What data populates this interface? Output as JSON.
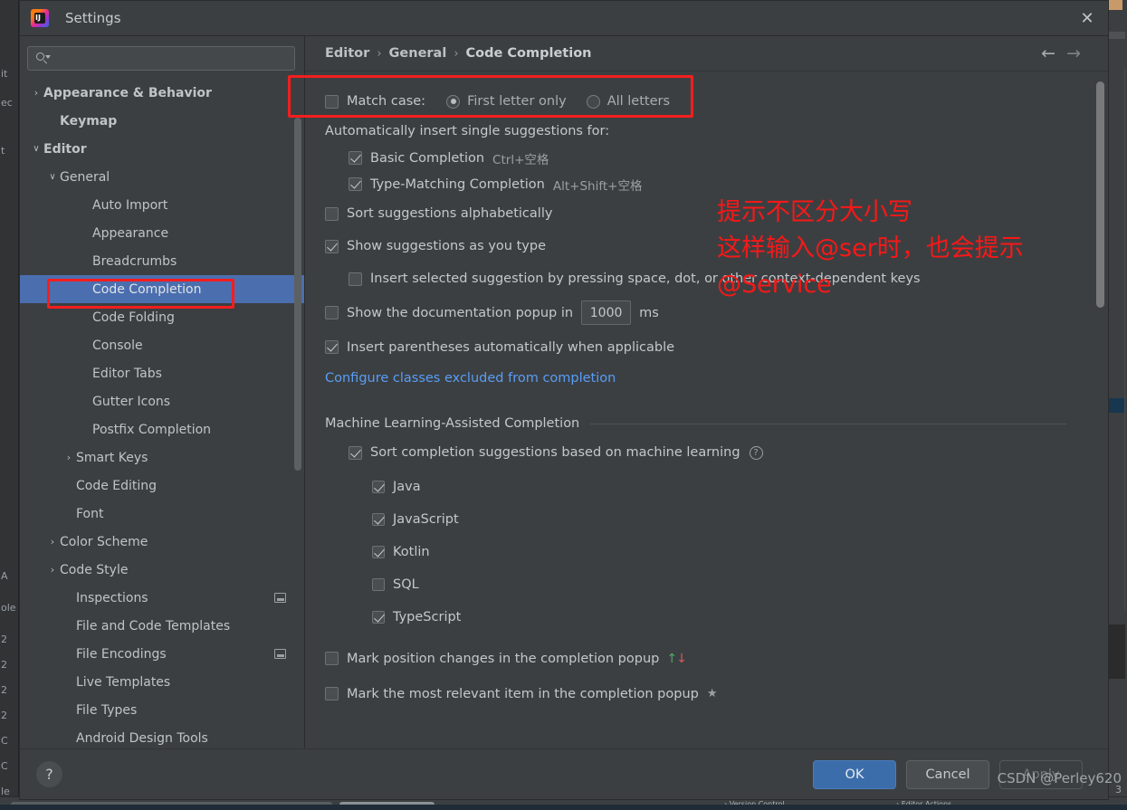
{
  "window": {
    "title": "Settings",
    "app_icon": "intellij-idea-icon",
    "close_label": "✕"
  },
  "search": {
    "value": "",
    "placeholder": ""
  },
  "sidebar": {
    "items": [
      {
        "label": "Appearance & Behavior",
        "arrow": "›",
        "indent": 0,
        "bold": true,
        "selected": false,
        "badge": false
      },
      {
        "label": "Keymap",
        "arrow": "",
        "indent": 1,
        "bold": true,
        "selected": false,
        "badge": false
      },
      {
        "label": "Editor",
        "arrow": "⌄",
        "indent": 0,
        "bold": true,
        "selected": false,
        "badge": false
      },
      {
        "label": "General",
        "arrow": "⌄",
        "indent": 1,
        "bold": false,
        "selected": false,
        "badge": false
      },
      {
        "label": "Auto Import",
        "arrow": "",
        "indent": 3,
        "bold": false,
        "selected": false,
        "badge": false
      },
      {
        "label": "Appearance",
        "arrow": "",
        "indent": 3,
        "bold": false,
        "selected": false,
        "badge": false
      },
      {
        "label": "Breadcrumbs",
        "arrow": "",
        "indent": 3,
        "bold": false,
        "selected": false,
        "badge": false
      },
      {
        "label": "Code Completion",
        "arrow": "",
        "indent": 3,
        "bold": false,
        "selected": true,
        "badge": false
      },
      {
        "label": "Code Folding",
        "arrow": "",
        "indent": 3,
        "bold": false,
        "selected": false,
        "badge": false
      },
      {
        "label": "Console",
        "arrow": "",
        "indent": 3,
        "bold": false,
        "selected": false,
        "badge": false
      },
      {
        "label": "Editor Tabs",
        "arrow": "",
        "indent": 3,
        "bold": false,
        "selected": false,
        "badge": false
      },
      {
        "label": "Gutter Icons",
        "arrow": "",
        "indent": 3,
        "bold": false,
        "selected": false,
        "badge": false
      },
      {
        "label": "Postfix Completion",
        "arrow": "",
        "indent": 3,
        "bold": false,
        "selected": false,
        "badge": false
      },
      {
        "label": "Smart Keys",
        "arrow": "›",
        "indent": 2,
        "bold": false,
        "selected": false,
        "badge": false
      },
      {
        "label": "Code Editing",
        "arrow": "",
        "indent": 2,
        "bold": false,
        "selected": false,
        "badge": false
      },
      {
        "label": "Font",
        "arrow": "",
        "indent": 2,
        "bold": false,
        "selected": false,
        "badge": false
      },
      {
        "label": "Color Scheme",
        "arrow": "›",
        "indent": 1,
        "bold": false,
        "selected": false,
        "badge": false
      },
      {
        "label": "Code Style",
        "arrow": "›",
        "indent": 1,
        "bold": false,
        "selected": false,
        "badge": false
      },
      {
        "label": "Inspections",
        "arrow": "",
        "indent": 2,
        "bold": false,
        "selected": false,
        "badge": true
      },
      {
        "label": "File and Code Templates",
        "arrow": "",
        "indent": 2,
        "bold": false,
        "selected": false,
        "badge": false
      },
      {
        "label": "File Encodings",
        "arrow": "",
        "indent": 2,
        "bold": false,
        "selected": false,
        "badge": true
      },
      {
        "label": "Live Templates",
        "arrow": "",
        "indent": 2,
        "bold": false,
        "selected": false,
        "badge": false
      },
      {
        "label": "File Types",
        "arrow": "",
        "indent": 2,
        "bold": false,
        "selected": false,
        "badge": false
      },
      {
        "label": "Android Design Tools",
        "arrow": "",
        "indent": 2,
        "bold": false,
        "selected": false,
        "badge": false
      }
    ]
  },
  "breadcrumb": {
    "parts": [
      "Editor",
      "General",
      "Code Completion"
    ],
    "separator": "›",
    "back_icon": "arrow-left-icon",
    "forward_icon": "arrow-right-icon"
  },
  "main": {
    "match_case": {
      "label": "Match case:",
      "checked": false,
      "options": [
        {
          "label": "First letter only",
          "selected": true
        },
        {
          "label": "All letters",
          "selected": false
        }
      ]
    },
    "auto_insert_header": "Automatically insert single suggestions for:",
    "auto_insert_items": [
      {
        "label": "Basic Completion",
        "shortcut": "Ctrl+空格",
        "checked": true
      },
      {
        "label": "Type-Matching Completion",
        "shortcut": "Alt+Shift+空格",
        "checked": true
      }
    ],
    "sort_alphabetically": {
      "label": "Sort suggestions alphabetically",
      "checked": false
    },
    "show_as_you_type": {
      "label": "Show suggestions as you type",
      "checked": true
    },
    "insert_selected": {
      "label": "Insert selected suggestion by pressing space, dot, or other context-dependent keys",
      "checked": false
    },
    "doc_popup": {
      "label": "Show the documentation popup in",
      "checked": false,
      "value": "1000",
      "unit": "ms"
    },
    "insert_parens": {
      "label": "Insert parentheses automatically when applicable",
      "checked": true
    },
    "configure_link": "Configure classes excluded from completion",
    "ml_section": {
      "title": "Machine Learning-Assisted Completion",
      "sort_ml": {
        "label": "Sort completion suggestions based on machine learning",
        "checked": true,
        "help": "?"
      },
      "languages": [
        {
          "label": "Java",
          "checked": true
        },
        {
          "label": "JavaScript",
          "checked": true
        },
        {
          "label": "Kotlin",
          "checked": true
        },
        {
          "label": "SQL",
          "checked": false
        },
        {
          "label": "TypeScript",
          "checked": true
        }
      ],
      "mark_position": {
        "label": "Mark position changes in the completion popup",
        "checked": false,
        "icon_up": "↑",
        "icon_down": "↓"
      },
      "mark_relevant": {
        "label": "Mark the most relevant item in the completion popup",
        "checked": false,
        "icon": "★"
      }
    }
  },
  "annotations": {
    "text_lines": "提示不区分大小写\n这样输入@ser时，也会提示\n@Service",
    "color": "#f71818"
  },
  "footer": {
    "help_label": "?",
    "ok_label": "OK",
    "cancel_label": "Cancel",
    "apply_label": "Apply"
  },
  "watermark": "CSDN @Perley620",
  "background": {
    "left_labels": [
      "it",
      "ec",
      "t",
      "A",
      "ole",
      "2",
      "2",
      "2",
      "2",
      "C",
      "C",
      "le"
    ],
    "status_items": [
      "› Version Control",
      "› Editor Actions"
    ],
    "right_edge_number": "3"
  },
  "colors": {
    "accent_selection": "#4b6eaf",
    "primary_button": "#3c6dab",
    "link": "#589df6",
    "annotation_red": "#f71818",
    "panel_bg": "#3c3f41"
  }
}
